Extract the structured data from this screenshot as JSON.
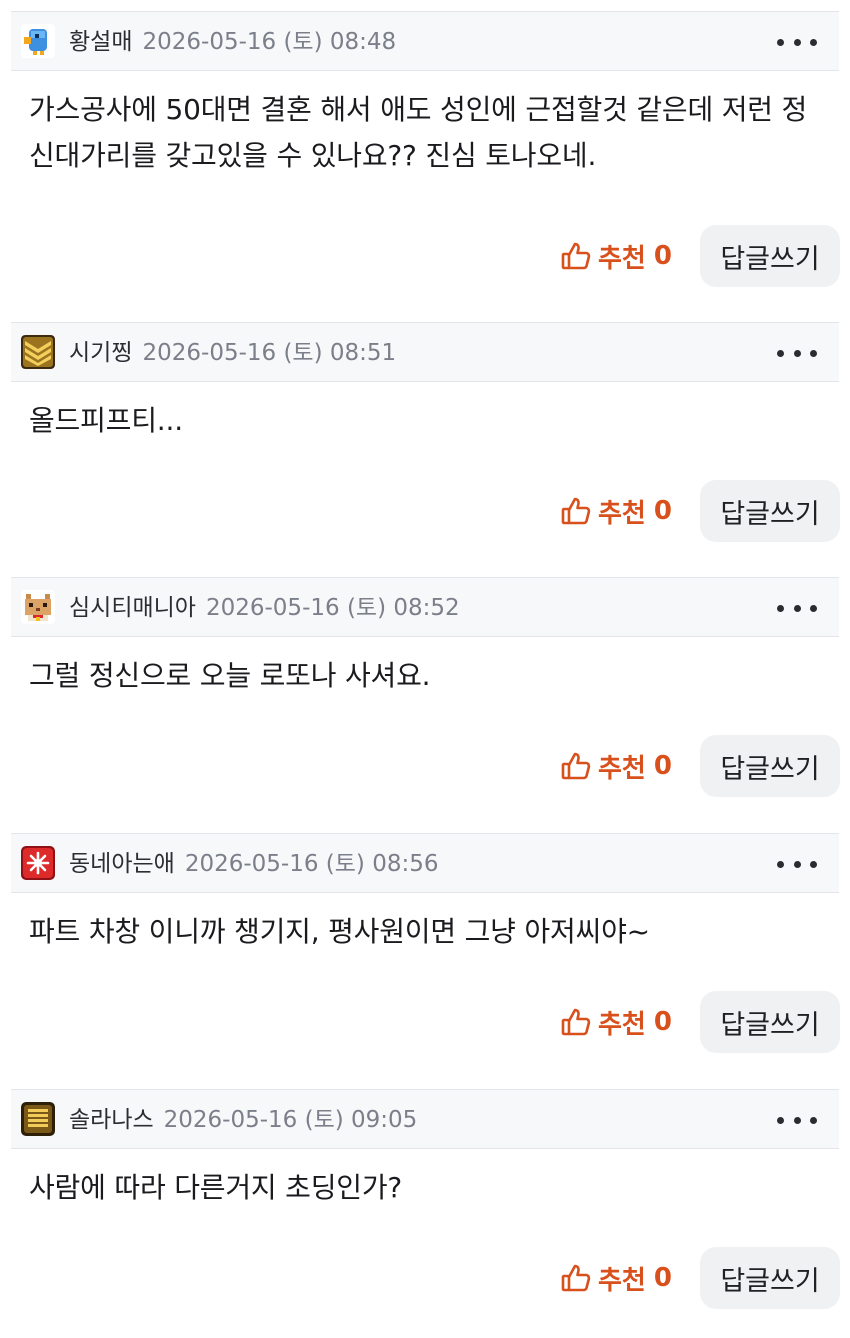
{
  "comments": [
    {
      "nickname": "황설매",
      "date": "2026-05-16 (토) 08:48",
      "text": "가스공사에 50대면 결혼 해서 애도 성인에 근접할것 같은데  저런 정신대가리를 갖고있을 수 있나요?? 진심 토나오네.",
      "like_label": "추천",
      "like_count": "0",
      "reply_label": "답글쓰기",
      "avatar": "blue-bird-icon",
      "more_icon": "more-dots-icon"
    },
    {
      "nickname": "시기찡",
      "date": "2026-05-16 (토) 08:51",
      "text": "올드피프티...",
      "like_label": "추천",
      "like_count": "0",
      "reply_label": "답글쓰기",
      "avatar": "gold-chevron-rank-icon",
      "more_icon": "more-dots-icon"
    },
    {
      "nickname": "심시티매니아",
      "date": "2026-05-16 (토) 08:52",
      "text": "그럴 정신으로 오늘 로또나 사셔요.",
      "like_label": "추천",
      "like_count": "0",
      "reply_label": "답글쓰기",
      "avatar": "pixel-cat-icon",
      "more_icon": "more-dots-icon"
    },
    {
      "nickname": "동네아는애",
      "date": "2026-05-16 (토) 08:56",
      "text": "파트 차창 이니까 챙기지, 평사원이면 그냥 아저씨야~",
      "like_label": "추천",
      "like_count": "0",
      "reply_label": "답글쓰기",
      "avatar": "red-burst-icon",
      "more_icon": "more-dots-icon"
    },
    {
      "nickname": "솔라나스",
      "date": "2026-05-16 (토) 09:05",
      "text": "사람에 따라 다른거지 초딩인가?",
      "like_label": "추천",
      "like_count": "0",
      "reply_label": "답글쓰기",
      "avatar": "gold-bars-rank-icon",
      "more_icon": "more-dots-icon"
    }
  ],
  "colors": {
    "header_bg": "#f7f8fa",
    "like_accent": "#d8501c",
    "reply_bg": "#f0f1f3",
    "date_gray": "#7b7f8a"
  }
}
